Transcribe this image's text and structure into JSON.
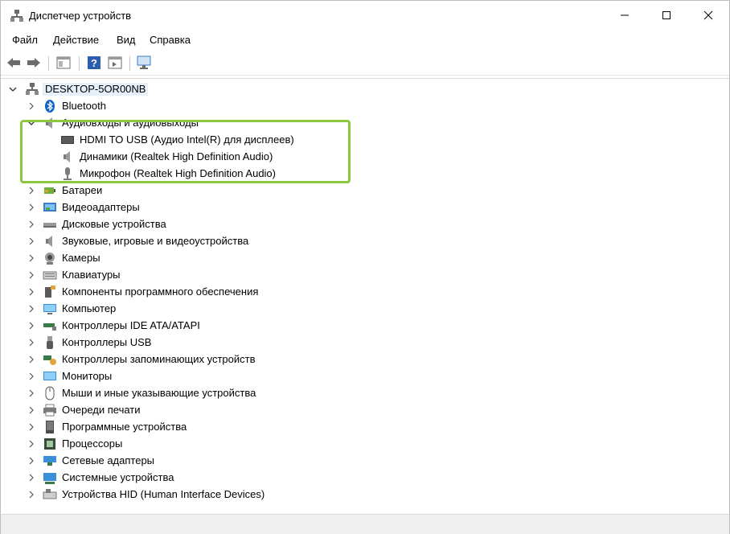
{
  "window": {
    "title": "Диспетчер устройств",
    "controls": [
      "minimize",
      "maximize",
      "close"
    ]
  },
  "menu": {
    "file": "Файл",
    "action": "Действие",
    "view": "Вид",
    "help": "Справка"
  },
  "toolbar": {
    "buttons": [
      "back-icon",
      "forward-icon",
      "properties-icon",
      "help-icon",
      "show-hidden-icon",
      "scan-hardware-icon"
    ]
  },
  "tree": {
    "root": "DESKTOP-5OR00NB",
    "bluetooth": "Bluetooth",
    "audio_io": "Аудиовходы и аудиовыходы",
    "audio_children": [
      "HDMI TO USB (Аудио Intel(R) для дисплеев)",
      "Динамики (Realtek High Definition Audio)",
      "Микрофон (Realtek High Definition Audio)"
    ],
    "categories": [
      "Батареи",
      "Видеоадаптеры",
      "Дисковые устройства",
      "Звуковые, игровые и видеоустройства",
      "Камеры",
      "Клавиатуры",
      "Компоненты программного обеспечения",
      "Компьютер",
      "Контроллеры IDE ATA/ATAPI",
      "Контроллеры USB",
      "Контроллеры запоминающих устройств",
      "Мониторы",
      "Мыши и иные указывающие устройства",
      "Очереди печати",
      "Программные устройства",
      "Процессоры",
      "Сетевые адаптеры",
      "Системные устройства",
      "Устройства HID (Human Interface Devices)"
    ]
  },
  "colors": {
    "highlight_border": "#8dc63f",
    "root_selection": "#e5f0fb",
    "accent_blue": "#0078d7"
  }
}
